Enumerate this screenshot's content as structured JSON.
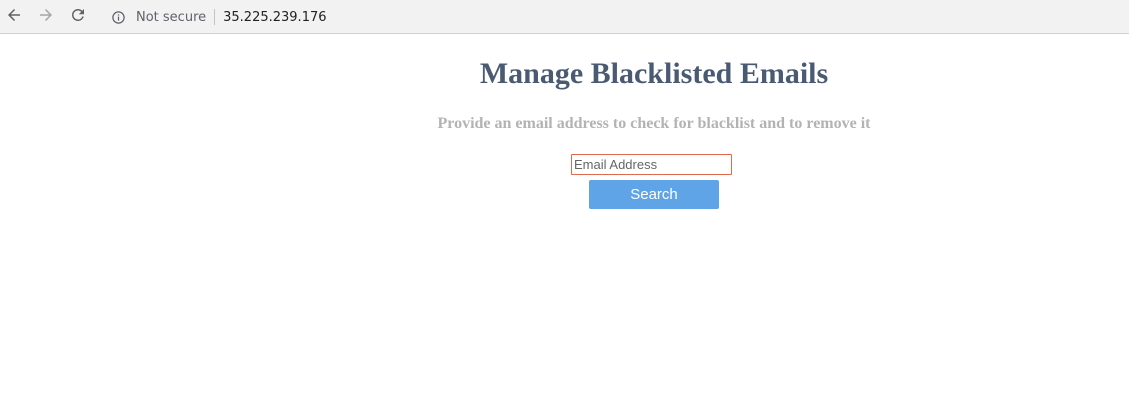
{
  "browser": {
    "security_text": "Not secure",
    "url": "35.225.239.176",
    "icons": {
      "back": "arrow-left-icon",
      "forward": "arrow-right-icon",
      "reload": "reload-icon",
      "info": "info-icon"
    }
  },
  "page": {
    "title": "Manage Blacklisted Emails",
    "subtitle": "Provide an email address to check for blacklist and to remove it",
    "email_input": {
      "placeholder": "Email Address",
      "value": ""
    },
    "search_button_label": "Search"
  },
  "colors": {
    "title": "#4a5a73",
    "subtitle": "#b3b3b3",
    "button_bg": "#5fa4e6",
    "input_border_focus": "#e06a4f"
  }
}
